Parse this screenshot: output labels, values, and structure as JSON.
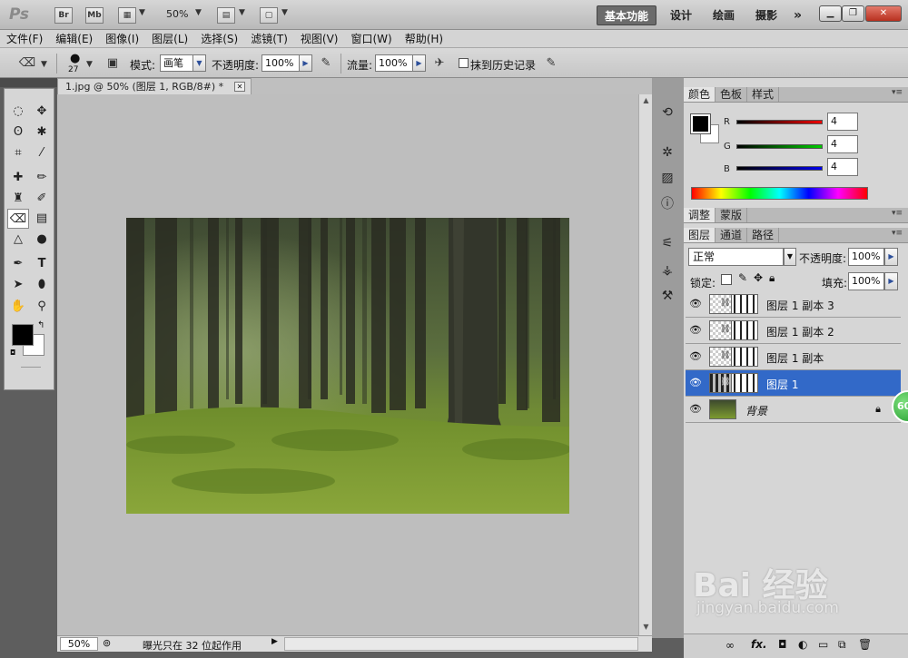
{
  "app": {
    "logo": "Ps"
  },
  "titlebar": {
    "icons": [
      "Br",
      "Mb"
    ],
    "zoom": "50%",
    "workspaces": [
      "基本功能",
      "设计",
      "绘画",
      "摄影"
    ],
    "more": "»"
  },
  "menu": [
    "文件(F)",
    "编辑(E)",
    "图像(I)",
    "图层(L)",
    "选择(S)",
    "滤镜(T)",
    "视图(V)",
    "窗口(W)",
    "帮助(H)"
  ],
  "options": {
    "brush_size": "27",
    "mode_label": "模式:",
    "mode_value": "画笔",
    "opacity_label": "不透明度:",
    "opacity_value": "100%",
    "flow_label": "流量:",
    "flow_value": "100%",
    "erase_history_label": "抹到历史记录"
  },
  "document": {
    "tab_title": "1.jpg @ 50% (图层 1, RGB/8#) *",
    "status_zoom": "50%",
    "status_text": "曝光只在 32 位起作用"
  },
  "color_panel": {
    "tabs": [
      "颜色",
      "色板",
      "样式"
    ],
    "channels": [
      {
        "label": "R",
        "value": "4",
        "color": "#cc0000"
      },
      {
        "label": "G",
        "value": "4",
        "color": "#00a000"
      },
      {
        "label": "B",
        "value": "4",
        "color": "#0000cc"
      }
    ]
  },
  "adjust_panel": {
    "tabs": [
      "调整",
      "蒙版"
    ]
  },
  "layers_panel": {
    "tabs": [
      "图层",
      "通道",
      "路径"
    ],
    "blend_mode": "正常",
    "opacity_label": "不透明度:",
    "opacity_value": "100%",
    "lock_label": "锁定:",
    "fill_label": "填充:",
    "fill_value": "100%",
    "layers": [
      {
        "name": "图层 1 副本 3",
        "selected": false
      },
      {
        "name": "图层 1 副本 2",
        "selected": false
      },
      {
        "name": "图层 1 副本",
        "selected": false
      },
      {
        "name": "图层 1",
        "selected": true
      },
      {
        "name": "背景",
        "selected": false
      }
    ]
  },
  "badge": "60",
  "watermark": {
    "text": "Bai 经验",
    "url": "jingyan.baidu.com"
  },
  "colors": {
    "selected_layer": "#3269c8",
    "workspace_active": "#6b6b6b"
  }
}
